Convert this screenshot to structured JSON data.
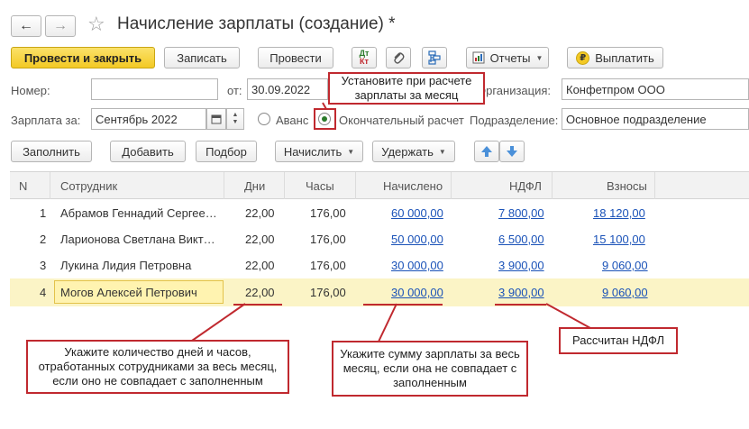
{
  "window": {
    "title": "Начисление зарплаты (создание) *"
  },
  "nav": {
    "back": "←",
    "forward": "→",
    "favorite": "☆"
  },
  "toolbar": {
    "post_close": "Провести и закрыть",
    "save": "Записать",
    "post": "Провести",
    "dtkt_top": "Дт",
    "dtkt_bottom": "Кт",
    "reports": "Отчеты",
    "pay": "Выплатить"
  },
  "form": {
    "number_label": "Номер:",
    "number_value": "",
    "date_label": "от:",
    "date_value": "30.09.2022",
    "org_label": "Организация:",
    "org_value": "Конфетпром ООО",
    "salary_for_label": "Зарплата за:",
    "salary_for_value": "Сентябрь 2022",
    "advance_label": "Аванс",
    "final_label": "Окончательный расчет",
    "dept_label": "Подразделение:",
    "dept_value": "Основное подразделение"
  },
  "table_toolbar": {
    "fill": "Заполнить",
    "add": "Добавить",
    "pick": "Подбор",
    "accrue": "Начислить",
    "withhold": "Удержать"
  },
  "table": {
    "columns": [
      "N",
      "Сотрудник",
      "Дни",
      "Часы",
      "Начислено",
      "НДФЛ",
      "Взносы"
    ],
    "rows": [
      {
        "n": "1",
        "employee": "Абрамов Геннадий Сергее…",
        "days": "22,00",
        "hours": "176,00",
        "accrued": "60 000,00",
        "ndfl": "7 800,00",
        "contrib": "18 120,00"
      },
      {
        "n": "2",
        "employee": "Ларионова Светлана Викт…",
        "days": "22,00",
        "hours": "176,00",
        "accrued": "50 000,00",
        "ndfl": "6 500,00",
        "contrib": "15 100,00"
      },
      {
        "n": "3",
        "employee": "Лукина Лидия Петровна",
        "days": "22,00",
        "hours": "176,00",
        "accrued": "30 000,00",
        "ndfl": "3 900,00",
        "contrib": "9 060,00"
      },
      {
        "n": "4",
        "employee": "Могов Алексей Петрович",
        "days": "22,00",
        "hours": "176,00",
        "accrued": "30 000,00",
        "ndfl": "3 900,00",
        "contrib": "9 060,00"
      }
    ]
  },
  "callouts": {
    "final_calc": "Установите при расчете зарплаты за месяц",
    "days_hours": "Укажите количество дней и часов, отработанных сотрудниками за весь месяц, если оно не совпадает с заполненным",
    "amount": "Укажите сумму зарплаты за весь месяц, если она не совпадает с заполненным",
    "ndfl": "Рассчитан НДФЛ"
  },
  "colors": {
    "accent_yellow": "#f3c924",
    "link_blue": "#1a52b8",
    "callout_red": "#c0292f",
    "selected_row": "#fbf4c6",
    "arrow_blue": "#4a90d9"
  }
}
